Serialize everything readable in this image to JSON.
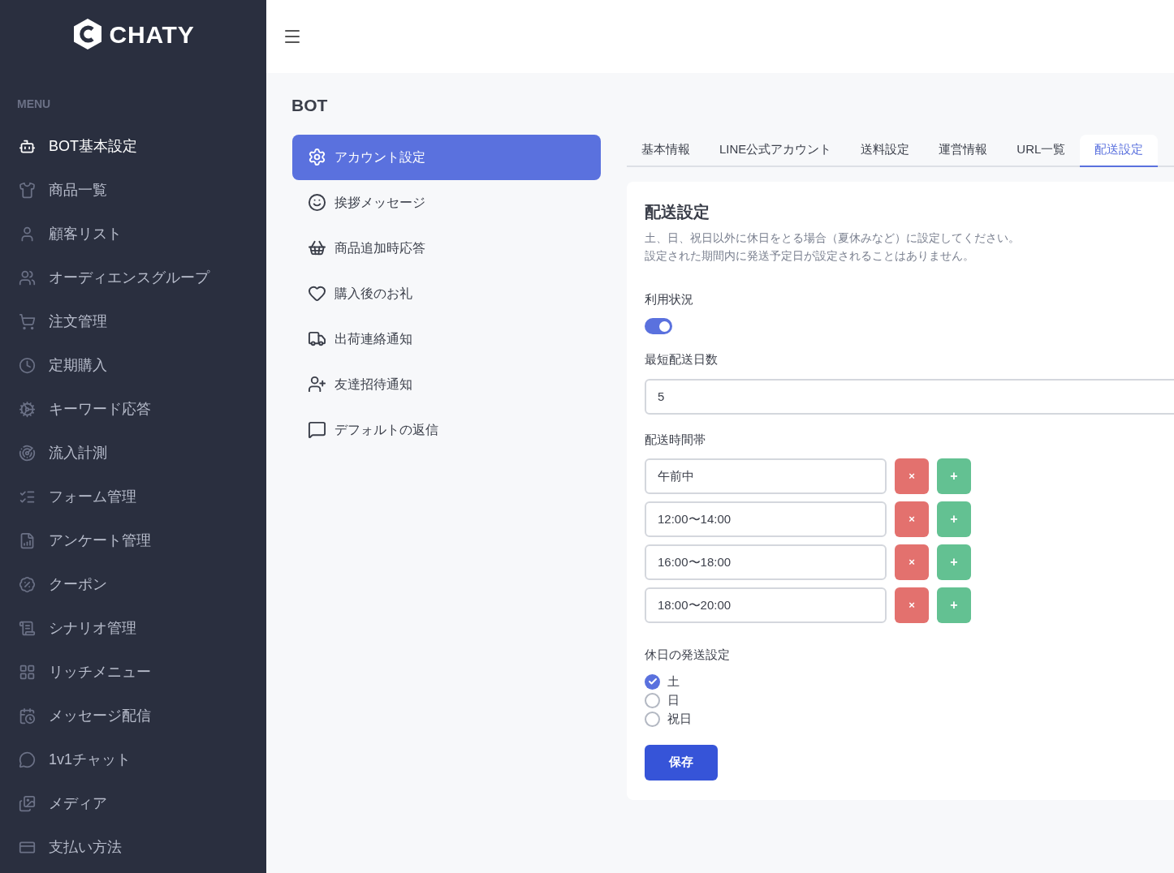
{
  "sidebar": {
    "logo": "CHATY",
    "menu_label": "MENU",
    "items": [
      {
        "label": "BOT基本設定",
        "selected": true
      },
      {
        "label": "商品一覧",
        "selected": false
      },
      {
        "label": "顧客リスト",
        "selected": false
      },
      {
        "label": "オーディエンスグループ",
        "selected": false
      },
      {
        "label": "注文管理",
        "selected": false
      },
      {
        "label": "定期購入",
        "selected": false
      },
      {
        "label": "キーワード応答",
        "selected": false
      },
      {
        "label": "流入計測",
        "selected": false
      },
      {
        "label": "フォーム管理",
        "selected": false
      },
      {
        "label": "アンケート管理",
        "selected": false
      },
      {
        "label": "クーポン",
        "selected": false
      },
      {
        "label": "シナリオ管理",
        "selected": false
      },
      {
        "label": "リッチメニュー",
        "selected": false
      },
      {
        "label": "メッセージ配信",
        "selected": false
      },
      {
        "label": "1v1チャット",
        "selected": false
      },
      {
        "label": "メディア",
        "selected": false
      },
      {
        "label": "支払い方法",
        "selected": false
      }
    ]
  },
  "page_title": "BOT",
  "submenu": [
    {
      "label": "アカウント設定",
      "selected": true
    },
    {
      "label": "挨拶メッセージ",
      "selected": false
    },
    {
      "label": "商品追加時応答",
      "selected": false
    },
    {
      "label": "購入後のお礼",
      "selected": false
    },
    {
      "label": "出荷連絡通知",
      "selected": false
    },
    {
      "label": "友達招待通知",
      "selected": false
    },
    {
      "label": "デフォルトの返信",
      "selected": false
    }
  ],
  "tabs": [
    {
      "label": "基本情報",
      "selected": false
    },
    {
      "label": "LINE公式アカウント",
      "selected": false
    },
    {
      "label": "送料設定",
      "selected": false
    },
    {
      "label": "運営情報",
      "selected": false
    },
    {
      "label": "URL一覧",
      "selected": false
    },
    {
      "label": "配送設定",
      "selected": true
    }
  ],
  "card": {
    "title": "配送設定",
    "description": [
      "土、日、祝日以外に休日をとる場合（夏休みなど）に設定してください。",
      "設定された期間内に発送予定日が設定されることはありません。"
    ],
    "usage_label": "利用状況",
    "usage_on": true,
    "min_days_label": "最短配送日数",
    "min_days_value": "5",
    "slots_label": "配送時間帯",
    "slots": [
      {
        "value": "午前中",
        "remove": "×",
        "add": "+"
      },
      {
        "value": "12:00〜14:00",
        "remove": "×",
        "add": "+"
      },
      {
        "value": "16:00〜18:00",
        "remove": "×",
        "add": "+"
      },
      {
        "value": "18:00〜20:00",
        "remove": "×",
        "add": "+"
      }
    ],
    "holiday_label": "休日の発送設定",
    "holidays": [
      {
        "label": "土",
        "checked": true
      },
      {
        "label": "日",
        "checked": false
      },
      {
        "label": "祝日",
        "checked": false
      }
    ],
    "save": "保存"
  }
}
